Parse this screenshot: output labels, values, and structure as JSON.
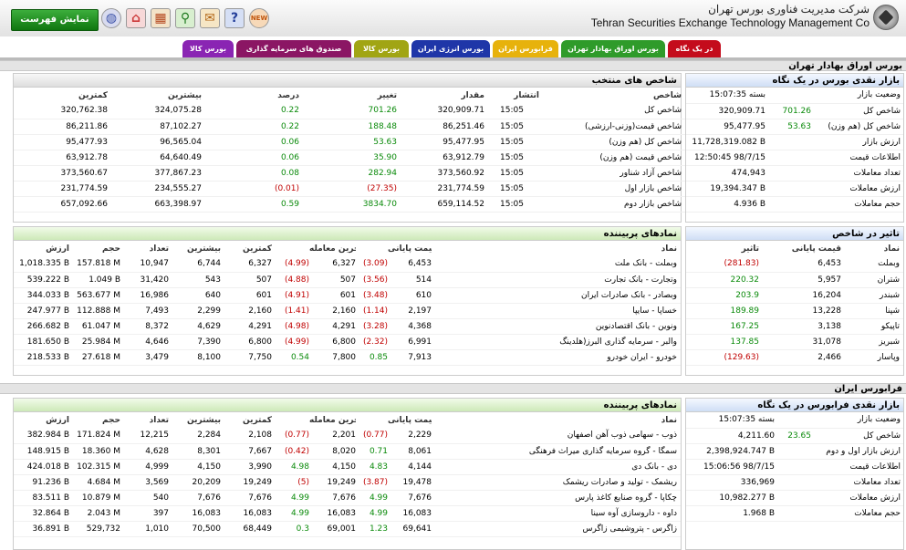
{
  "header": {
    "company_fa": "شرکت مدیریت فناوری بورس تهران",
    "company_en": "Tehran Securities Exchange Technology Management Co",
    "menu_button": "نمایش فهرست",
    "icons": [
      "new-icon",
      "help-icon",
      "chat-icon",
      "search-icon",
      "calculator-icon",
      "home-icon",
      "globe-icon"
    ],
    "new_label": "NEW",
    "help_label": "?"
  },
  "tabs": [
    {
      "label": "در یک نگاه",
      "color": "#c40c1c",
      "active": true
    },
    {
      "label": "بورس اوراق بهادار تهران",
      "color": "#2f9b2a"
    },
    {
      "label": "فرابورس ایران",
      "color": "#e7b20c"
    },
    {
      "label": "بورس انرژی ایران",
      "color": "#1f36a8"
    },
    {
      "label": "بورس کالا",
      "color": "#a1a514"
    },
    {
      "label": "صندوق های سرمایه گذاری",
      "color": "#8b1664"
    },
    {
      "label": "بورس کالا",
      "color": "#8a25b3"
    }
  ],
  "tse": {
    "section_title": "بورس اوراق بهادار تهران",
    "market": {
      "title": "بازار نقدی بورس در یک نگاه",
      "rows": [
        {
          "label": "وضعیت بازار",
          "value": "بسته 15:07:35"
        },
        {
          "label": "شاخص کل",
          "change": "701.26",
          "value": "320,909.71"
        },
        {
          "label": "شاخص کل (هم وزن)",
          "change": "53.63",
          "value": "95,477.95"
        },
        {
          "label": "ارزش بازار",
          "value": "11,728,319.082 B"
        },
        {
          "label": "اطلاعات قیمت",
          "value": "12:50:45 98/7/15"
        },
        {
          "label": "تعداد معاملات",
          "value": "474,943"
        },
        {
          "label": "ارزش معاملات",
          "value": "19,394.347 B"
        },
        {
          "label": "حجم معاملات",
          "value": "4.936 B"
        }
      ]
    },
    "indices": {
      "title": "شاخص های منتخب",
      "headers": [
        "شاخص",
        "انتشار",
        "مقدار",
        "تغییر",
        "درصد",
        "بیشترین",
        "کمترین"
      ],
      "rows": [
        [
          "شاخص کل",
          "15:05",
          "320,909.71",
          "701.26",
          "0.22",
          "324,075.28",
          "320,762.38"
        ],
        [
          "شاخص قیمت(وزنی-ارزشی)",
          "15:05",
          "86,251.46",
          "188.48",
          "0.22",
          "87,102.27",
          "86,211.86"
        ],
        [
          "شاخص کل (هم وزن)",
          "15:05",
          "95,477.95",
          "53.63",
          "0.06",
          "96,565.04",
          "95,477.93"
        ],
        [
          "شاخص قیمت (هم وزن)",
          "15:05",
          "63,912.79",
          "35.90",
          "0.06",
          "64,640.49",
          "63,912.78"
        ],
        [
          "شاخص آزاد شناور",
          "15:05",
          "373,560.92",
          "282.94",
          "0.08",
          "377,867.23",
          "373,560.67"
        ],
        [
          "شاخص بازار اول",
          "15:05",
          "231,774.59",
          "(27.35)",
          "(0.01)",
          "234,555.27",
          "231,774.59"
        ],
        [
          "شاخص بازار دوم",
          "15:05",
          "659,114.52",
          "3834.70",
          "0.59",
          "663,398.97",
          "657,092.66"
        ]
      ]
    },
    "impact": {
      "title": "تاثیر در شاخص",
      "headers": [
        "نماد",
        "قیمت پایانی",
        "تاثیر"
      ],
      "rows": [
        [
          "وبملت",
          "6,453",
          "(281.83)"
        ],
        [
          "شتران",
          "5,957",
          "220.32"
        ],
        [
          "شبندر",
          "16,204",
          "203.9"
        ],
        [
          "شپنا",
          "13,228",
          "189.89"
        ],
        [
          "تاپیکو",
          "3,138",
          "167.25"
        ],
        [
          "شبریز",
          "31,078",
          "137.85"
        ],
        [
          "وپاسار",
          "2,466",
          "(129.63)"
        ]
      ]
    },
    "symbols": {
      "title": "نمادهای پربیننده",
      "headers": [
        "نماد",
        "قیمت پایانی",
        "",
        "آخرین معامله",
        "",
        "کمترین",
        "بیشترین",
        "تعداد",
        "حجم",
        "ارزش"
      ],
      "rows": [
        [
          "وبملت - بانک ملت",
          "6,453",
          "(3.09)",
          "6,327",
          "(4.99)",
          "6,327",
          "6,744",
          "10,947",
          "157.818 M",
          "1,018.335 B"
        ],
        [
          "وتجارت - بانک تجارت",
          "514",
          "(3.56)",
          "507",
          "(4.88)",
          "507",
          "543",
          "31,420",
          "1.049 B",
          "539.222 B"
        ],
        [
          "وبصادر - بانک صادرات ایران",
          "610",
          "(3.48)",
          "601",
          "(4.91)",
          "601",
          "640",
          "16,986",
          "563.677 M",
          "344.033 B"
        ],
        [
          "خساپا - سایپا",
          "2,197",
          "(1.14)",
          "2,160",
          "(1.41)",
          "2,160",
          "2,299",
          "7,493",
          "112.888 M",
          "247.977 B"
        ],
        [
          "ونوین - بانک اقتصادنوین",
          "4,368",
          "(3.28)",
          "4,291",
          "(4.98)",
          "4,291",
          "4,629",
          "8,372",
          "61.047 M",
          "266.682 B"
        ],
        [
          "والبر - سرمایه گذاری البرز(هلدینگ",
          "6,991",
          "(2.32)",
          "6,800",
          "(4.99)",
          "6,800",
          "7,390",
          "4,646",
          "25.984 M",
          "181.650 B"
        ],
        [
          "خودرو - ایران خودرو",
          "7,913",
          "0.85",
          "7,800",
          "0.54",
          "7,750",
          "8,100",
          "3,479",
          "27.618 M",
          "218.533 B"
        ]
      ]
    }
  },
  "ifb": {
    "section_title": "فرابورس ایران",
    "market": {
      "title": "بازار نقدی فرابورس در یک نگاه",
      "rows": [
        {
          "label": "وضعیت بازار",
          "value": "بسته 15:07:35"
        },
        {
          "label": "شاخص کل",
          "change": "23.65",
          "value": "4,211.60"
        },
        {
          "label": "ارزش بازار اول و دوم",
          "value": "2,398,924.747 B"
        },
        {
          "label": "اطلاعات قیمت",
          "value": "15:06:56 98/7/15"
        },
        {
          "label": "تعداد معاملات",
          "value": "336,969"
        },
        {
          "label": "ارزش معاملات",
          "value": "10,982.277 B"
        },
        {
          "label": "حجم معاملات",
          "value": "1.968 B"
        }
      ]
    },
    "symbols": {
      "title": "نمادهای پربیننده",
      "headers": [
        "نماد",
        "قیمت پایانی",
        "",
        "آخرین معامله",
        "",
        "کمترین",
        "بیشترین",
        "تعداد",
        "حجم",
        "ارزش"
      ],
      "rows": [
        [
          "ذوب - سهامی ذوب آهن اصفهان",
          "2,229",
          "(0.77)",
          "2,201",
          "(0.77)",
          "2,108",
          "2,284",
          "12,215",
          "171.824 M",
          "382.984 B"
        ],
        [
          "سمگا - گروه سرمایه گذاری میراث فرهنگی",
          "8,061",
          "0.71",
          "8,020",
          "(0.42)",
          "7,667",
          "8,301",
          "4,628",
          "18.360 M",
          "148.915 B"
        ],
        [
          "دی - بانک دی",
          "4,144",
          "4.83",
          "4,150",
          "4.98",
          "3,990",
          "4,150",
          "4,999",
          "102.315 M",
          "424.018 B"
        ],
        [
          "ریشمک - تولید و صادرات ریشمک",
          "19,478",
          "(3.87)",
          "19,249",
          "(5)",
          "19,249",
          "20,209",
          "3,569",
          "4.684 M",
          "91.236 B"
        ],
        [
          "چکاپا - گروه صنایع کاغذ پارس",
          "7,676",
          "4.99",
          "7,676",
          "4.99",
          "7,676",
          "7,676",
          "540",
          "10.879 M",
          "83.511 B"
        ],
        [
          "داوه - داروسازی آوه سینا",
          "16,083",
          "4.99",
          "16,083",
          "4.99",
          "16,083",
          "16,083",
          "397",
          "2.043 M",
          "32.864 B"
        ],
        [
          "زاگرس - پتروشیمی زاگرس",
          "69,641",
          "1.23",
          "69,001",
          "0.3",
          "68,449",
          "70,500",
          "1,010",
          "529,732",
          "36.891 B"
        ]
      ]
    }
  }
}
